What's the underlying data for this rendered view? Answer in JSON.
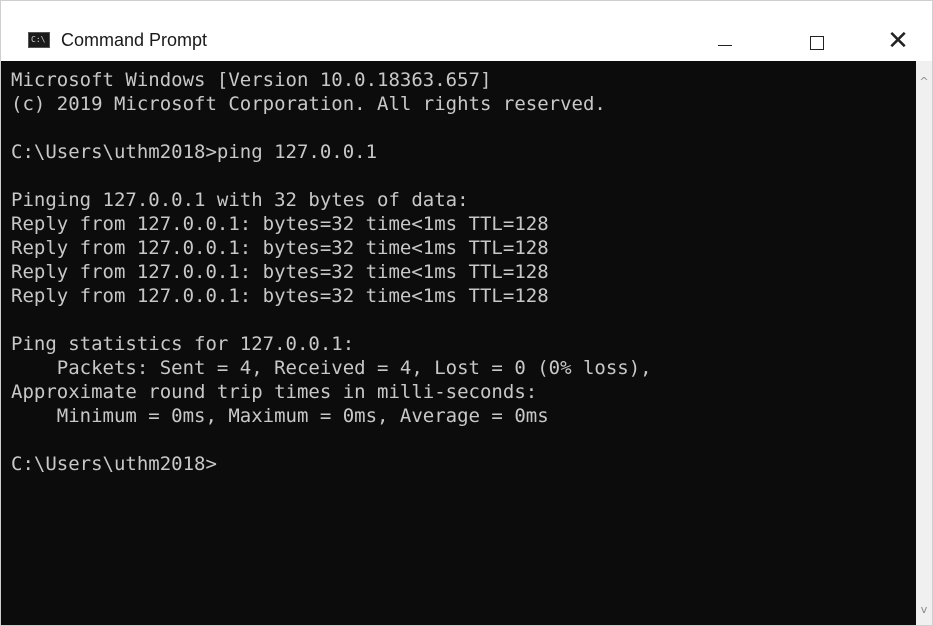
{
  "window": {
    "title": "Command Prompt",
    "icon": "cmd-app-icon",
    "icon_label": "C:\\",
    "controls": {
      "minimize": "minimize-icon",
      "maximize": "maximize-icon",
      "close": "close-icon"
    }
  },
  "console": {
    "lines": [
      "Microsoft Windows [Version 10.0.18363.657]",
      "(c) 2019 Microsoft Corporation. All rights reserved.",
      "",
      "C:\\Users\\uthm2018>ping 127.0.0.1",
      "",
      "Pinging 127.0.0.1 with 32 bytes of data:",
      "Reply from 127.0.0.1: bytes=32 time<1ms TTL=128",
      "Reply from 127.0.0.1: bytes=32 time<1ms TTL=128",
      "Reply from 127.0.0.1: bytes=32 time<1ms TTL=128",
      "Reply from 127.0.0.1: bytes=32 time<1ms TTL=128",
      "",
      "Ping statistics for 127.0.0.1:",
      "    Packets: Sent = 4, Received = 4, Lost = 0 (0% loss),",
      "Approximate round trip times in milli-seconds:",
      "    Minimum = 0ms, Maximum = 0ms, Average = 0ms",
      "",
      "C:\\Users\\uthm2018>"
    ]
  },
  "scrollbar": {
    "up_icon": "scroll-up-arrow-icon",
    "down_icon": "scroll-down-arrow-icon",
    "up_glyph": "^",
    "down_glyph": "v"
  },
  "colors": {
    "console_bg": "#0c0c0c",
    "console_text": "#c8c8c8",
    "titlebar_bg": "#ffffff"
  }
}
